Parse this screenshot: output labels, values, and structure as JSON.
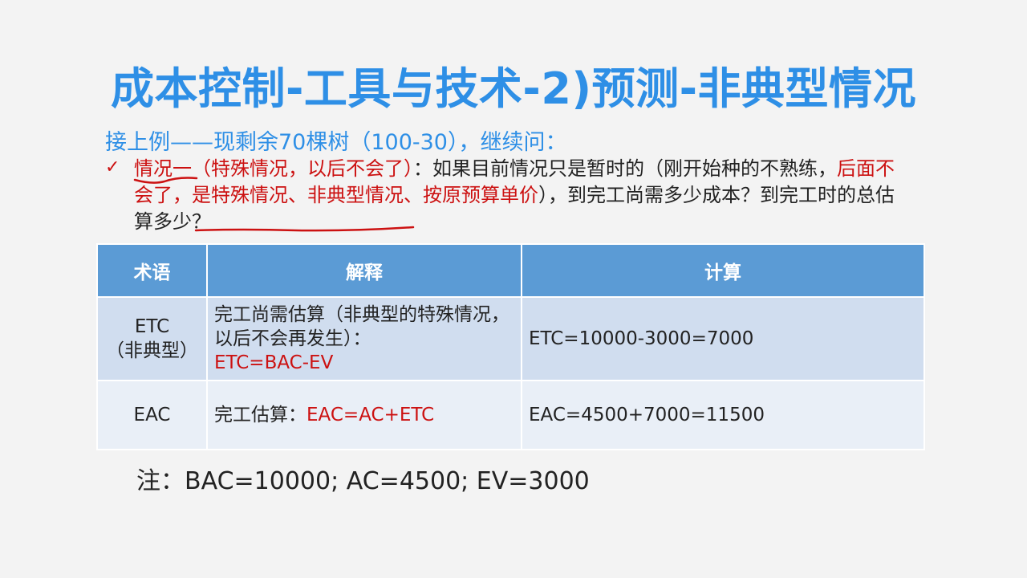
{
  "title": "成本控制-工具与技术-2)预测-非典型情况",
  "intro": "接上例——现剩余70棵树（100-30），继续问：",
  "case": {
    "check_mark": "✓",
    "label": "情况一（特殊情况，以后不会了）",
    "text_a": "：如果目前情况只是暂时的（刚开始种的不熟练，",
    "red_b": "后面不会了，是特殊情况、非典型情况、按原预算单价",
    "text_c": "），到完工尚需多少成本？到完工时的总估算多少？"
  },
  "table": {
    "headers": [
      "术语",
      "解释",
      "计算"
    ],
    "rows": [
      {
        "term": "ETC",
        "term_sub": "（非典型）",
        "explain_text": "完工尚需估算（非典型的特殊情况，以后不会再发生）：",
        "explain_formula": "ETC=BAC-EV",
        "calc": "ETC=10000-3000=7000"
      },
      {
        "term": "EAC",
        "term_sub": "",
        "explain_text": "完工估算：",
        "explain_formula": "EAC=AC+ETC",
        "calc": "EAC=4500+7000=11500"
      }
    ]
  },
  "note": "注：BAC=10000; AC=4500; EV=3000",
  "colors": {
    "accent_blue": "#2e8fe6",
    "header_blue": "#5b9bd5",
    "red": "#cc1111",
    "row1": "#d0ddef",
    "row2": "#e9eff7"
  }
}
